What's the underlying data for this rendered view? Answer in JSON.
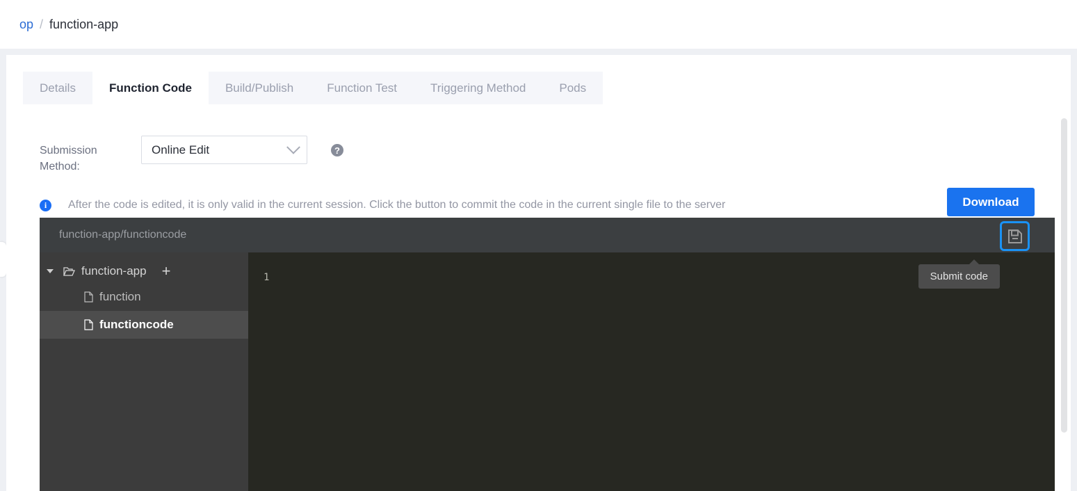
{
  "breadcrumb": {
    "root": "op",
    "separator": "/",
    "current": "function-app"
  },
  "tabs": [
    {
      "label": "Details",
      "active": false
    },
    {
      "label": "Function Code",
      "active": true
    },
    {
      "label": "Build/Publish",
      "active": false
    },
    {
      "label": "Function Test",
      "active": false
    },
    {
      "label": "Triggering Method",
      "active": false
    },
    {
      "label": "Pods",
      "active": false
    }
  ],
  "submission": {
    "label": "Submission Method:",
    "selected": "Online Edit",
    "help_glyph": "?",
    "chevron": "chevron-down-icon"
  },
  "notice": {
    "icon_glyph": "i",
    "text": "After the code is edited, it is only valid in the current session. Click the button to commit the code in the current single file to the server",
    "download_label": "Download"
  },
  "editor": {
    "path": "function-app/functioncode",
    "save_tooltip": "Submit code",
    "line_number": "1",
    "code": "",
    "tree": {
      "root_label": "function-app",
      "add_label": "+",
      "files": [
        {
          "label": "function",
          "selected": false
        },
        {
          "label": "functioncode",
          "selected": true
        }
      ]
    }
  },
  "colors": {
    "accent_blue": "#1a73ef",
    "link_blue": "#2b6cd4",
    "focus_ring": "#1a92f5",
    "editor_bg": "#272822",
    "tree_bg": "#3c3c3c",
    "header_bg": "#3c3f41"
  }
}
